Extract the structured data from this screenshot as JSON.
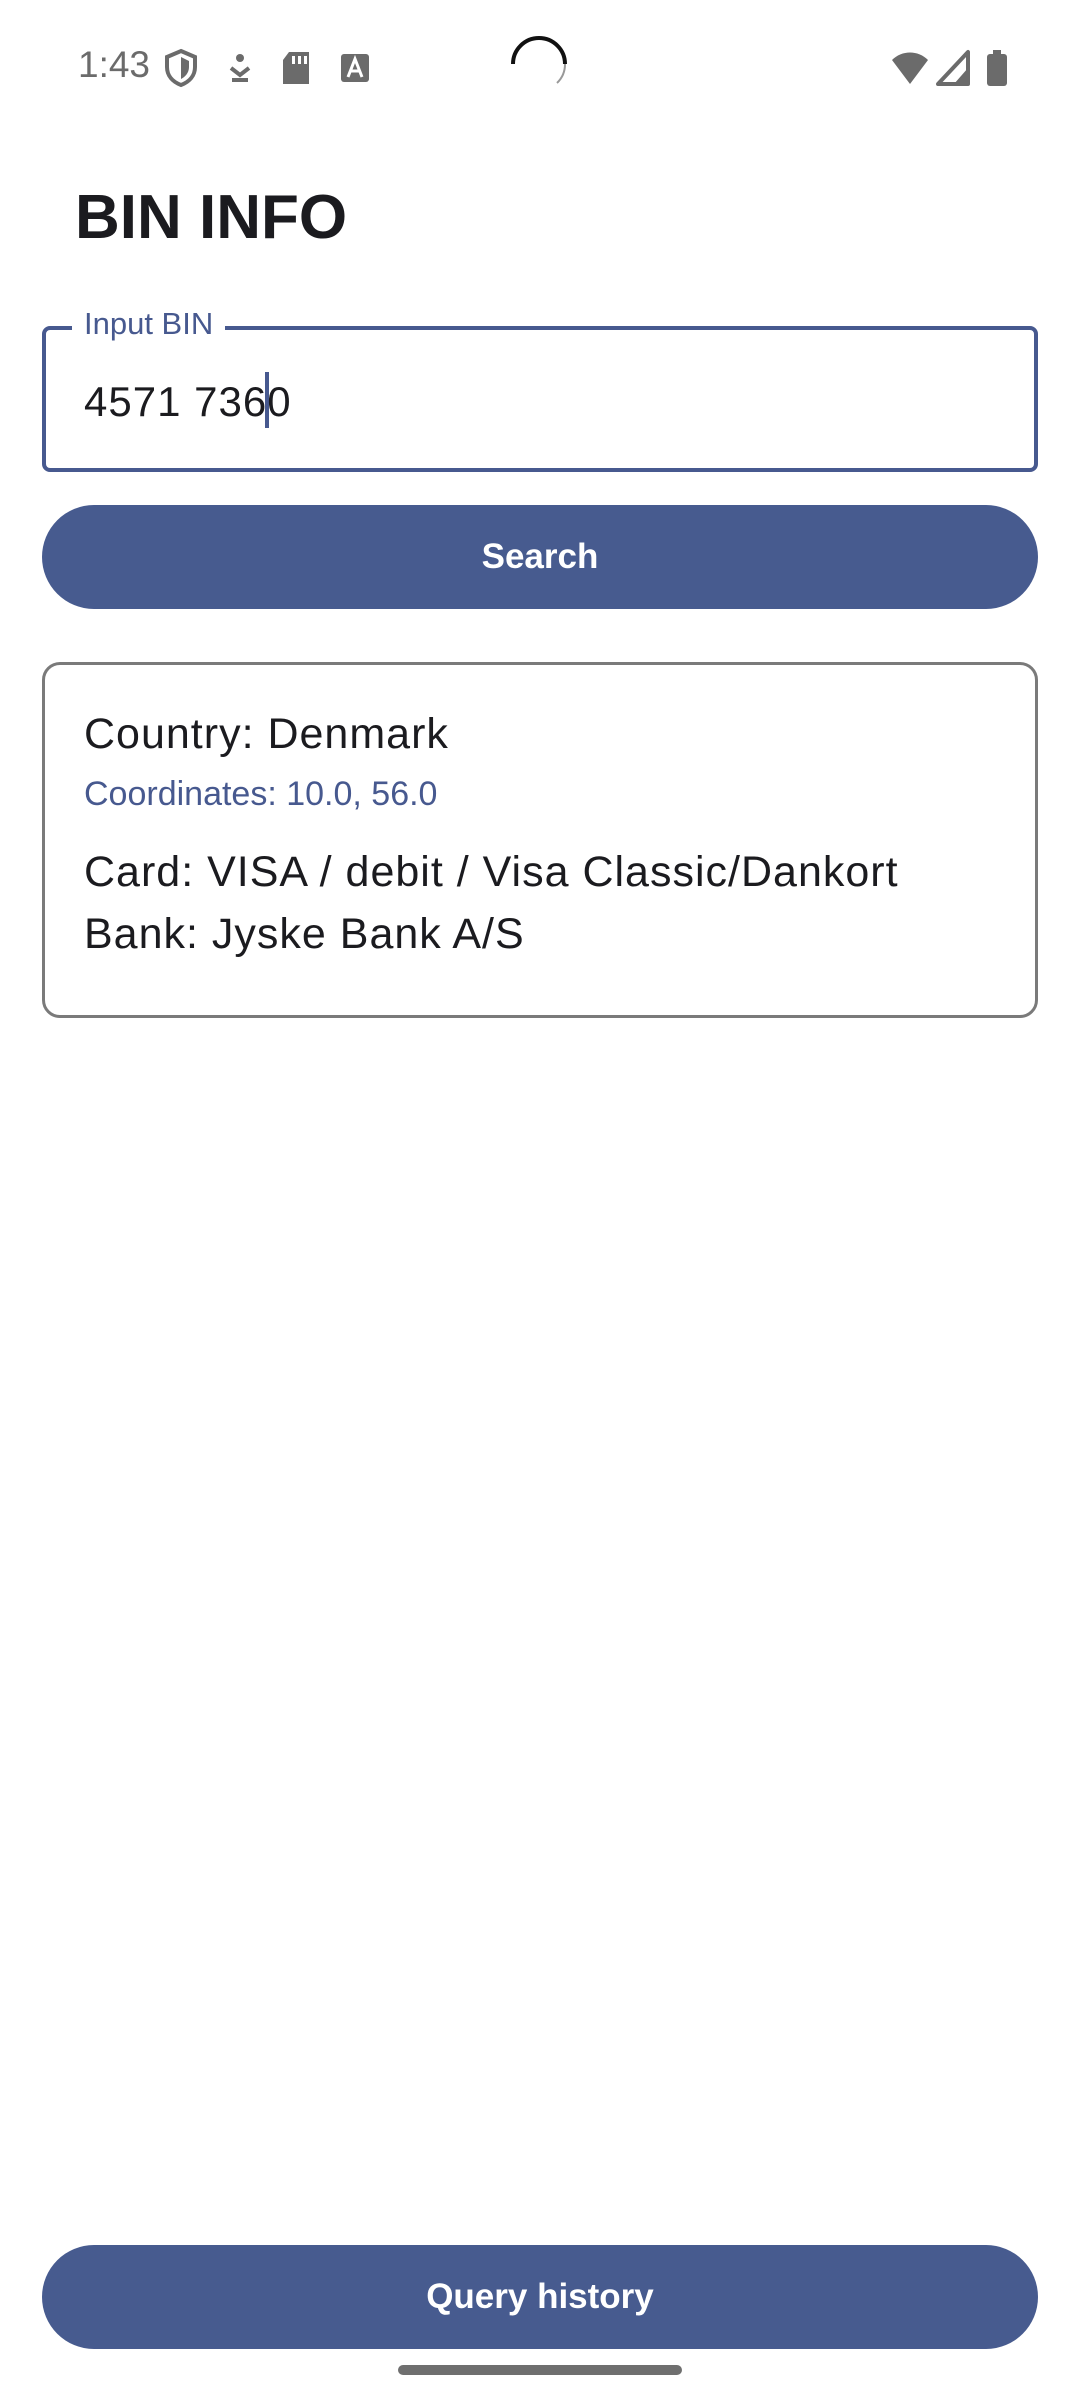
{
  "status_bar": {
    "time": "1:43",
    "left_icons": [
      "shield-icon",
      "download-icon",
      "sd-card-icon",
      "font-a-icon"
    ],
    "right_icons": [
      "wifi-icon",
      "cell-signal-icon",
      "battery-icon"
    ]
  },
  "header": {
    "title": "BIN INFO"
  },
  "bin_input": {
    "label": "Input BIN",
    "value_before_cursor": "4571 736",
    "value_after_cursor": "0"
  },
  "search_button": {
    "label": "Search"
  },
  "result": {
    "country": "Country: Denmark",
    "coordinates": "Coordinates: 10.0, 56.0",
    "card": "Card: VISA / debit / Visa Classic/Dankort",
    "bank": "Bank: Jyske Bank A/S"
  },
  "history_button": {
    "label": "Query history"
  },
  "colors": {
    "accent": "#475b8f",
    "title_text": "#1b1b1f",
    "card_border": "#7a7a7a"
  }
}
